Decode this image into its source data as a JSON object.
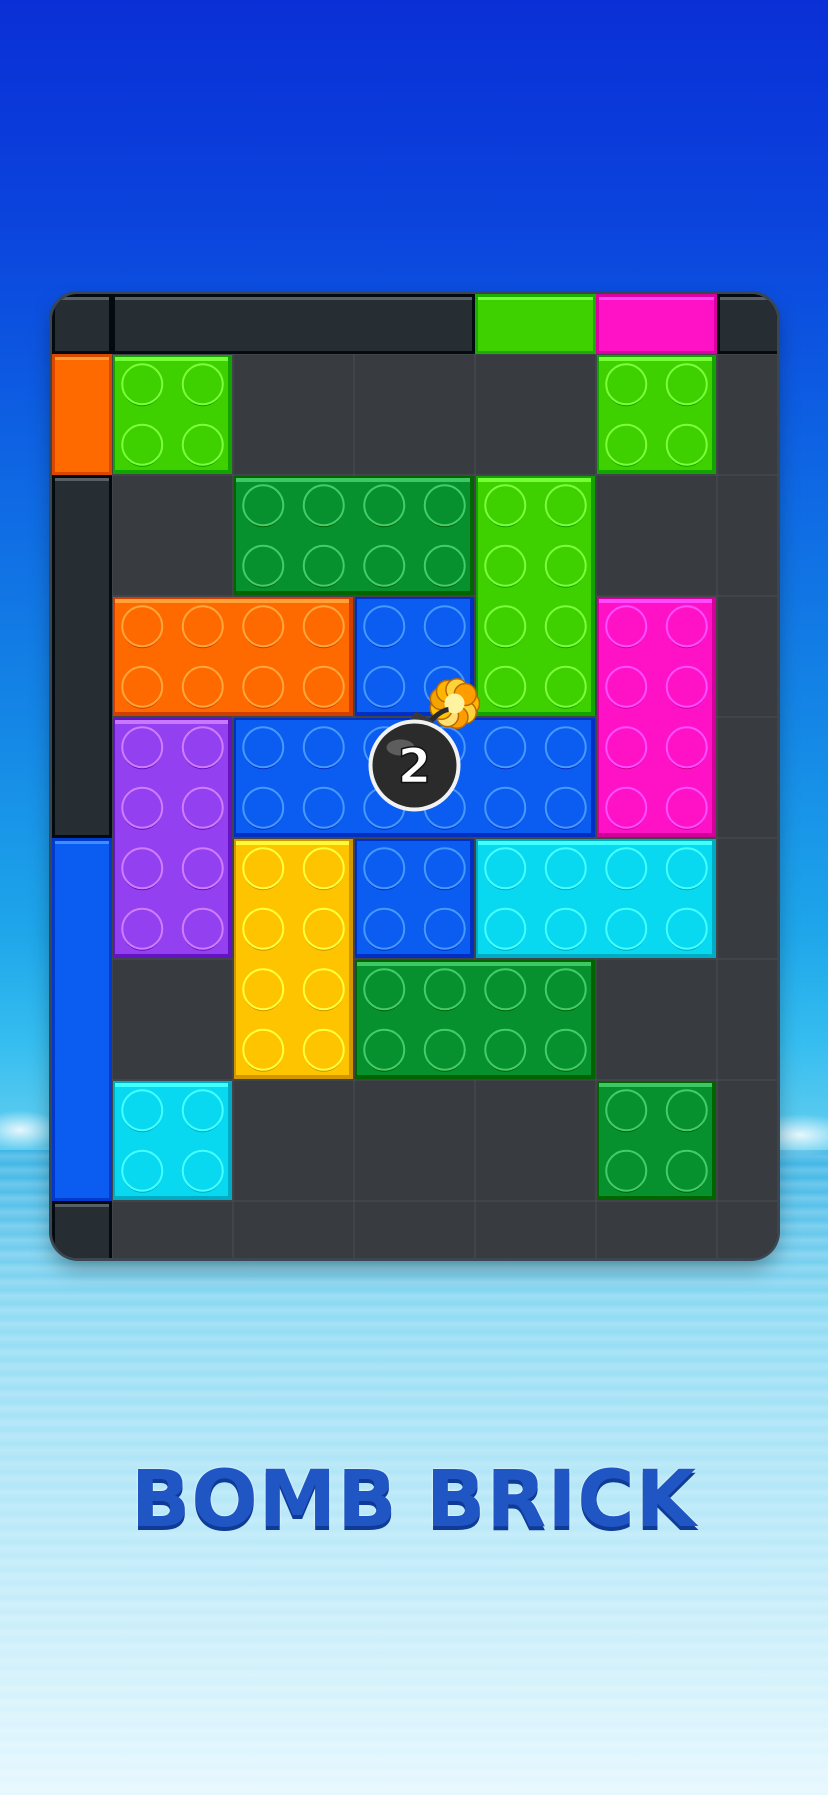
{
  "title": "BOMB BRICK",
  "bomb": {
    "count": "2"
  },
  "colors": {
    "orange": "#ff6a00",
    "lime": "#3fd000",
    "green": "#07912e",
    "magenta": "#ff12c6",
    "purple": "#9340f0",
    "blue": "#0b5cf0",
    "yellow": "#ffc400",
    "cyan": "#08d9f0",
    "dark": "#262d33",
    "empty": "#383b3f"
  },
  "grid": {
    "cols": 6,
    "rows": 8
  },
  "bricks": [
    {
      "color": "lime",
      "c": 0,
      "r": 0,
      "w": 1,
      "h": 1
    },
    {
      "color": "lime",
      "c": 4,
      "r": 0,
      "w": 1,
      "h": 1
    },
    {
      "color": "green",
      "c": 1,
      "r": 1,
      "w": 2,
      "h": 1
    },
    {
      "color": "lime",
      "c": 3,
      "r": 1,
      "w": 1,
      "h": 2
    },
    {
      "color": "orange",
      "c": 0,
      "r": 2,
      "w": 2,
      "h": 1
    },
    {
      "color": "magenta",
      "c": 4,
      "r": 2,
      "w": 1,
      "h": 2
    },
    {
      "color": "purple",
      "c": 0,
      "r": 3,
      "w": 1,
      "h": 2
    },
    {
      "color": "yellow",
      "c": 1,
      "r": 4,
      "w": 1,
      "h": 2
    },
    {
      "color": "cyan",
      "c": 3,
      "r": 4,
      "w": 2,
      "h": 1
    },
    {
      "color": "green",
      "c": 2,
      "r": 5,
      "w": 2,
      "h": 1
    },
    {
      "color": "cyan",
      "c": 0,
      "r": 6,
      "w": 1,
      "h": 1
    },
    {
      "color": "green",
      "c": 4,
      "r": 6,
      "w": 1,
      "h": 1
    }
  ],
  "blue_plus": [
    {
      "c": 2,
      "r": 2,
      "w": 1,
      "h": 1
    },
    {
      "c": 1,
      "r": 3,
      "w": 3,
      "h": 1
    },
    {
      "c": 2,
      "r": 4,
      "w": 1,
      "h": 1
    }
  ],
  "borders": {
    "top": [
      {
        "color": "dark",
        "from": 0,
        "to": 3
      },
      {
        "color": "lime",
        "from": 3,
        "to": 4
      },
      {
        "color": "magenta",
        "from": 4,
        "to": 5
      },
      {
        "color": "dark",
        "from": 5,
        "to": 6
      }
    ],
    "bottom": [
      {
        "color": "purple",
        "from": 0,
        "to": 1
      },
      {
        "color": "yellow",
        "from": 1,
        "to": 2
      },
      {
        "color": "green",
        "from": 2,
        "to": 4
      },
      {
        "color": "dark",
        "from": 4,
        "to": 5
      },
      {
        "color": "dark",
        "from": 5,
        "to": 6
      }
    ],
    "left": [
      {
        "color": "orange",
        "from": 0,
        "to": 1
      },
      {
        "color": "dark",
        "from": 1,
        "to": 4
      },
      {
        "color": "blue",
        "from": 4,
        "to": 7
      },
      {
        "color": "dark",
        "from": 7,
        "to": 8
      }
    ],
    "right": [
      {
        "color": "dark",
        "from": 0,
        "to": 2
      },
      {
        "color": "dark",
        "from": 2,
        "to": 5
      },
      {
        "color": "cyan",
        "from": 5,
        "to": 6
      },
      {
        "color": "dark",
        "from": 6,
        "to": 8
      }
    ]
  }
}
